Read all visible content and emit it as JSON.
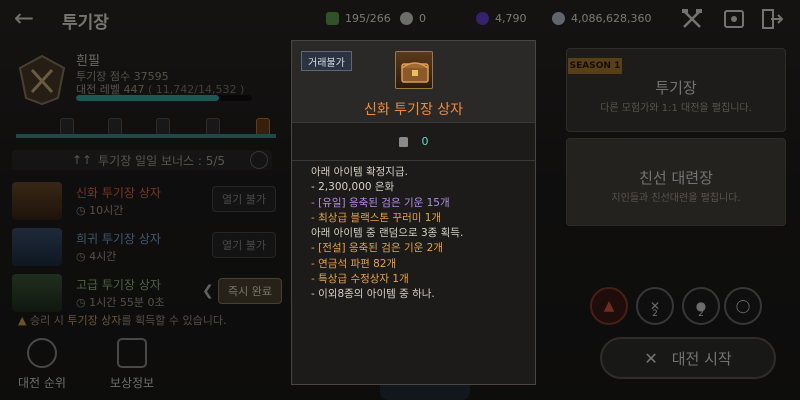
{
  "header": {
    "title": "투기장",
    "resources": [
      {
        "icon": "energy-icon",
        "value": "195/266",
        "color": "#5aa04a"
      },
      {
        "icon": "pearl-icon",
        "value": "0",
        "color": "#cfcfcf"
      },
      {
        "icon": "crystal-icon",
        "value": "4,790",
        "color": "#6a3fd0"
      },
      {
        "icon": "silver-coin-icon",
        "value": "4,086,628,360",
        "color": "#b8c4d4"
      }
    ]
  },
  "profile": {
    "name": "흰필",
    "score_text": "투기장 점수 37595",
    "level_prefix": "대전 레벨 447",
    "level_progress": "( 11,742/14,532 )",
    "xp_fraction": 0.81
  },
  "bonus": {
    "label": "투기장 일일 보너스 : 5/5"
  },
  "rewards": [
    {
      "name": "신화 투기장 상자",
      "time": "10시간",
      "button": "열기 불가",
      "name_color": "#e06a3a"
    },
    {
      "name": "희귀 투기장 상자",
      "time": "4시간",
      "button": "열기 불가",
      "name_color": "#7aa6d8"
    },
    {
      "name": "고급 투기장 상자",
      "time": "1시간 55분 0초",
      "button": "즉시 완료",
      "name_color": "#8fbf7a"
    }
  ],
  "notice": {
    "prefix": "승리 시 ",
    "highlight": "투기장 상자",
    "suffix": "를 획득할 수 있습니다."
  },
  "bottom_nav": [
    {
      "label": "대전 순위",
      "icon": "trophy-icon"
    },
    {
      "label": "보상정보",
      "icon": "reward-info-icon"
    }
  ],
  "right_panels": {
    "season_badge": "SEASON 1",
    "arena_title": "투기장",
    "arena_sub": "다른 모험가와 1:1 대전을 펼칩니다.",
    "friendly_title": "친선 대련장",
    "friendly_sub": "지인들과 친선대련을 펼칩니다."
  },
  "skill_levels": [
    "",
    "2",
    "2",
    ""
  ],
  "start_button": "대전 시작",
  "tooltip": {
    "badge": "거래불가",
    "item_name": "신화 투기장 상자",
    "count": "0",
    "lines": [
      {
        "text": "아래 아이템 확정지급.",
        "color": "white"
      },
      {
        "text": "- 2,300,000 은화",
        "color": "white"
      },
      {
        "text": "- [유일] 응축된 검은 기운 15개",
        "color": "purple"
      },
      {
        "text": "- 최상급 블랙스톤 꾸러미 1개",
        "color": "orange"
      },
      {
        "text": "아래 아이템 중 랜덤으로 3종 획득.",
        "color": "white"
      },
      {
        "text": "- [전설] 응축된 검은 기운 2개",
        "color": "orange"
      },
      {
        "text": "- 연금석 파편 82개",
        "color": "orange"
      },
      {
        "text": "- 특상급 수정상자 1개",
        "color": "orange"
      },
      {
        "text": "- 이외8종의 아이템 중 하나.",
        "color": "white"
      }
    ]
  }
}
